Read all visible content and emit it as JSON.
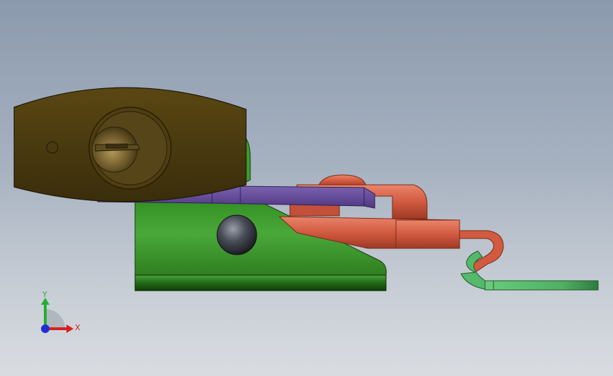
{
  "viewport": {
    "background_top": "#8b9aad",
    "background_bottom": "#d9dde2"
  },
  "model": {
    "parts": [
      {
        "name": "padlock-body",
        "color": "#4f3e12"
      },
      {
        "name": "keyway",
        "color": "#8a7440"
      },
      {
        "name": "latch-base",
        "color": "#3a9a2a"
      },
      {
        "name": "latch-plate",
        "color": "#6a4d9a"
      },
      {
        "name": "shackle",
        "color": "#d8644a"
      },
      {
        "name": "spring-wire",
        "color": "#55b86a"
      },
      {
        "name": "pivot-knob",
        "color": "#4a4e58"
      }
    ]
  },
  "triad": {
    "x_label": "X",
    "y_label": "Y",
    "x_color": "#d42020",
    "y_color": "#20b030",
    "z_color": "#2030d0"
  }
}
